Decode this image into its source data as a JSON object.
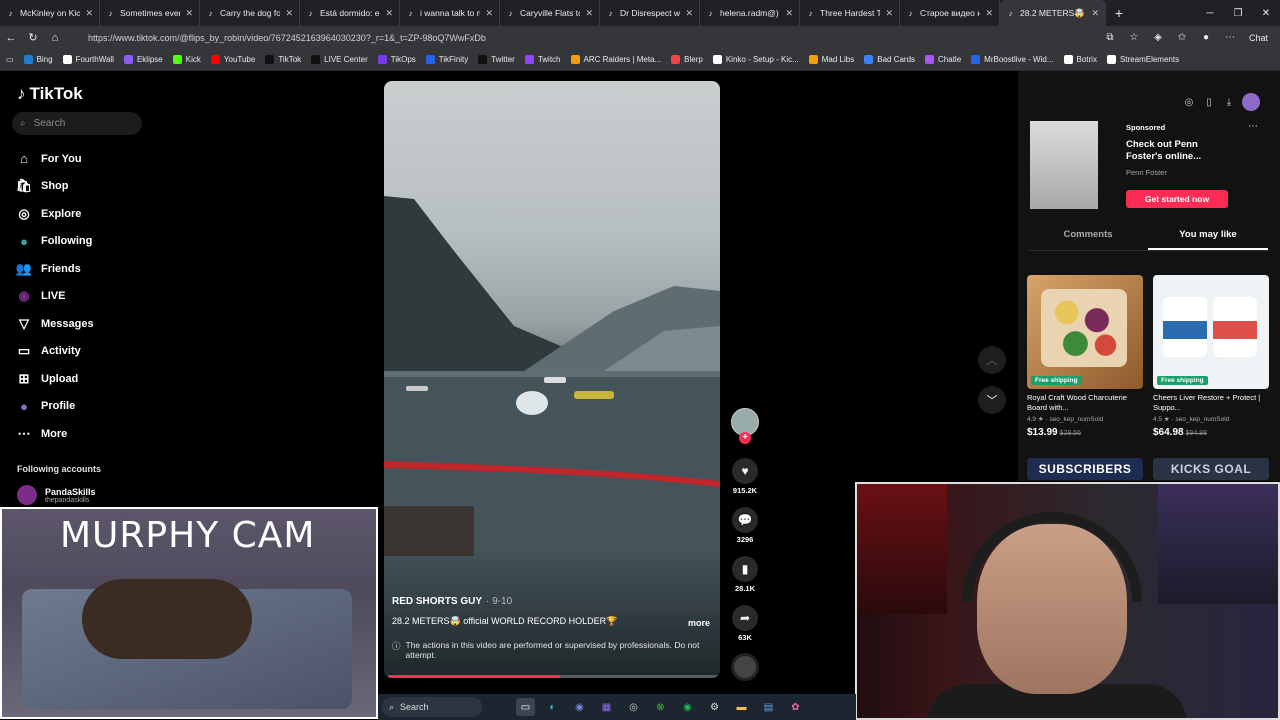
{
  "browser": {
    "tabs": [
      {
        "title": "McKinley on Kick (8",
        "icon": "tiktok-icon"
      },
      {
        "title": "Sometimes everythi",
        "icon": "tiktok-icon"
      },
      {
        "title": "Carry the dog food",
        "icon": "tiktok-icon"
      },
      {
        "title": "Está dormido: el se",
        "icon": "tiktok-icon"
      },
      {
        "title": "i wanna talk to my",
        "icon": "tiktok-icon"
      },
      {
        "title": "Caryville Flats to Ho",
        "icon": "tiktok-icon"
      },
      {
        "title": "Dr Disrespect wife d",
        "icon": "tiktok-icon"
      },
      {
        "title": "helena.radm@) Ша",
        "icon": "tiktok-icon"
      },
      {
        "title": "Three Hardest Thing",
        "icon": "tiktok-icon"
      },
      {
        "title": "Старое видео наш",
        "icon": "tiktok-icon"
      },
      {
        "title": "28.2 METERS🤯 off",
        "icon": "tiktok-icon",
        "active": true
      }
    ],
    "url": "https://www.tiktok.com/@flips_by_robin/video/7672452163964030230?_r=1&_t=ZP-98oQ7WwFxDb",
    "chat_label": "Chat",
    "bookmarks": [
      {
        "label": "Bing",
        "color": "#1e7fd8"
      },
      {
        "label": "FourthWall",
        "color": "#ffffff"
      },
      {
        "label": "Eklipse",
        "color": "#8b5cf6"
      },
      {
        "label": "Kick",
        "color": "#53fc18"
      },
      {
        "label": "YouTube",
        "color": "#ff0000"
      },
      {
        "label": "TikTok",
        "color": "#111111"
      },
      {
        "label": "LIVE Center",
        "color": "#111111"
      },
      {
        "label": "TikOps",
        "color": "#7c3aed"
      },
      {
        "label": "TikFinity",
        "color": "#2563eb"
      },
      {
        "label": "Twitter",
        "color": "#111111"
      },
      {
        "label": "Twitch",
        "color": "#9146ff"
      },
      {
        "label": "ARC Raiders | Meta...",
        "color": "#f59e0b"
      },
      {
        "label": "Blerp",
        "color": "#ef4444"
      },
      {
        "label": "Kinko - Setup - Kic...",
        "color": "#ffffff"
      },
      {
        "label": "Mad Libs",
        "color": "#f59e0b"
      },
      {
        "label": "Bad Cards",
        "color": "#3b82f6"
      },
      {
        "label": "Chatle",
        "color": "#a855f7"
      },
      {
        "label": "MrBoostlive - Wid...",
        "color": "#2563eb"
      },
      {
        "label": "Botrix",
        "color": "#ffffff"
      },
      {
        "label": "StreamElements",
        "color": "#ffffff"
      }
    ]
  },
  "tiktok": {
    "brand": "TikTok",
    "search_placeholder": "Search",
    "nav": [
      {
        "label": "For You",
        "icon": "home-icon"
      },
      {
        "label": "Shop",
        "icon": "shop-icon"
      },
      {
        "label": "Explore",
        "icon": "compass-icon"
      },
      {
        "label": "Following",
        "icon": "following-avatar-icon"
      },
      {
        "label": "Friends",
        "icon": "friends-icon"
      },
      {
        "label": "LIVE",
        "icon": "live-icon"
      },
      {
        "label": "Messages",
        "icon": "messages-icon"
      },
      {
        "label": "Activity",
        "icon": "activity-icon"
      },
      {
        "label": "Upload",
        "icon": "upload-icon"
      },
      {
        "label": "Profile",
        "icon": "profile-avatar-icon"
      },
      {
        "label": "More",
        "icon": "more-icon"
      }
    ],
    "following_header": "Following accounts",
    "following": [
      {
        "name": "PandaSkills",
        "handle": "thepandaskills"
      }
    ],
    "video": {
      "author": "RED SHORTS GUY",
      "date": "· 9-10",
      "caption": "28.2 METERS🤯 official WORLD RECORD HOLDER🏆",
      "more": "more",
      "notice": "The actions in this video are performed or supervised by professionals. Do not attempt.",
      "progress": 0.52
    },
    "actions": {
      "likes": "915.2K",
      "comments": "3296",
      "saves": "28.1K",
      "shares": "63K"
    }
  },
  "sidepanel": {
    "sponsored_label": "Sponsored",
    "ad_title": "Check out Penn Foster's online...",
    "ad_brand": "Penn Foster",
    "ad_cta": "Get started now",
    "tabs": [
      "Comments",
      "You may like"
    ],
    "active_tab": "You may like",
    "products": [
      {
        "name": "Royal Craft Wood Charcuterie Board with...",
        "rating": "4.9 ★ · seo_kep_numSold",
        "price": "$13.99",
        "old_price": "$28.56",
        "badge": "Free shipping"
      },
      {
        "name": "Cheers Liver Restore + Protect | Suppo...",
        "rating": "4.5 ★ · seo_kep_numSold",
        "price": "$64.98",
        "old_price": "$94.98",
        "badge": "Free shipping"
      }
    ],
    "banners": [
      "SUBSCRIBERS",
      "KICKS GOAL"
    ]
  },
  "overlays": {
    "murphy_cam": "MURPHY CAM"
  },
  "taskbar": {
    "search": "Search"
  }
}
